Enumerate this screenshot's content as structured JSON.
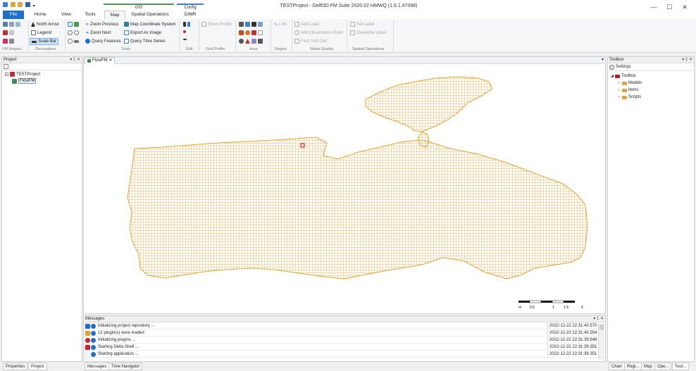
{
  "window": {
    "title": "TESTProject - Delft3D FM Suite 2020.02 HMWQ (1.6.1.47098)",
    "minimize": "—",
    "maximize": "☐",
    "close": "✕",
    "ribbon_toggle": "⌃"
  },
  "context_tabs": {
    "gis_label": "GIS",
    "config_label": "Config",
    "gis_color": "#4c9a4c",
    "config_color": "#3b7dd8"
  },
  "tabs": [
    "File",
    "Home",
    "View",
    "Tools",
    "Map",
    "Spatial Operations",
    "DIMR"
  ],
  "ribbon": {
    "decorations": {
      "north_arrow": "North Arrow",
      "legend": "Legend",
      "scale_bar": "Scale Bar",
      "label": "Decorations"
    },
    "fm_region_label": "FM Region...",
    "tools": {
      "zoom_previous": "Zoom Previous",
      "zoom_next": "Zoom Next",
      "query_features": "Query Features",
      "map_coordinate_system": "Map Coordinate System",
      "export_as_image": "Export As Image",
      "query_time_series": "Query Time Series",
      "label": "Tools"
    },
    "edit_label": "Edit",
    "grid_profile": {
      "show_profile": "Show Profile",
      "label": "Grid Profile"
    },
    "area_label": "Area",
    "region": {
      "link": "Link",
      "label": "Region"
    },
    "water_quality": {
      "add_load": "Add Load",
      "add_observation_point": "Add Observation Point",
      "find_grid_cell": "Find Grid Cell",
      "label": "Water Quality"
    },
    "spatial_operations": {
      "set_label": "Set Label",
      "overwrite_label": "Overwrite Label",
      "label": "Spatial Operations"
    }
  },
  "project_panel": {
    "title": "Project",
    "controls": "▾ ‡ ✕",
    "root": "TESTProject",
    "child": "FlowFM"
  },
  "document": {
    "tab": "FlowFM",
    "tab_close": "✕",
    "dropdown": "▾",
    "grid_color": "#e0a534",
    "selection_color": "#e02020"
  },
  "scale_bar": {
    "unit": "m",
    "ticks": [
      "0.5",
      "1",
      "1.5",
      "2"
    ]
  },
  "toolbox_panel": {
    "title": "Toolbox",
    "controls": "▾ ‡ ✕",
    "settings": "Settings",
    "root": "Toolbox",
    "items": [
      "Models",
      "Items",
      "Scripts"
    ]
  },
  "messages_panel": {
    "title": "Messages",
    "controls": "▾ ‡ ✕",
    "rows": [
      {
        "text": "Initializing project repository ...",
        "time": "2022-12-22 22:31:40.570"
      },
      {
        "text": "12 plugin(s) were loaded",
        "time": "2022-12-22 22:31:40.554"
      },
      {
        "text": "Initializing plugins ...",
        "time": "2022-12-22 22:31:39.648"
      },
      {
        "text": "Starting Delta Shell ...",
        "time": "2022-12-22 22:31:39.351"
      },
      {
        "text": "Starting application ...",
        "time": "2022-12-22 22:31:39.351"
      }
    ],
    "filter_colors": [
      "#1e6fc8",
      "#e0a020",
      "#d02020",
      "#d02020"
    ]
  },
  "bottom_tabs": {
    "left": [
      "Properties",
      "Project"
    ],
    "center": [
      "Messages",
      "Time Navigator"
    ],
    "right": [
      "Chart",
      "Regi...",
      "Map",
      "Ope...",
      "Tool..."
    ]
  }
}
